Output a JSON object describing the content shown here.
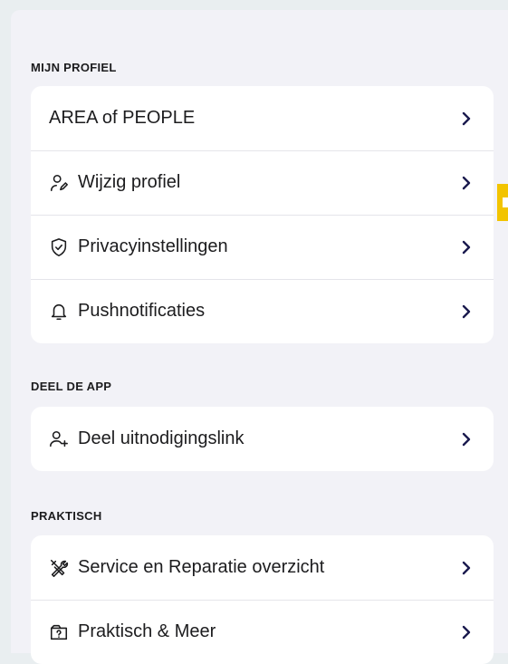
{
  "sections": [
    {
      "header": "MIJN PROFIEL",
      "items": [
        {
          "label": "AREA of PEOPLE",
          "icon": ""
        },
        {
          "label": "Wijzig profiel",
          "icon": "user-edit-icon"
        },
        {
          "label": "Privacyinstellingen",
          "icon": "shield-check-icon"
        },
        {
          "label": "Pushnotificaties",
          "icon": "bell-icon"
        }
      ]
    },
    {
      "header": "DEEL DE APP",
      "items": [
        {
          "label": "Deel uitnodigingslink",
          "icon": "user-plus-icon"
        }
      ]
    },
    {
      "header": "PRAKTISCH",
      "items": [
        {
          "label": "Service en Reparatie overzicht",
          "icon": "tools-icon"
        },
        {
          "label": "Praktisch & Meer",
          "icon": "help-box-icon"
        }
      ]
    }
  ],
  "colors": {
    "background": "#e9eef0",
    "panel": "#f2f2f7",
    "card": "#ffffff",
    "chevron": "#1a1a4e",
    "accent_marker": "#f2c400"
  }
}
